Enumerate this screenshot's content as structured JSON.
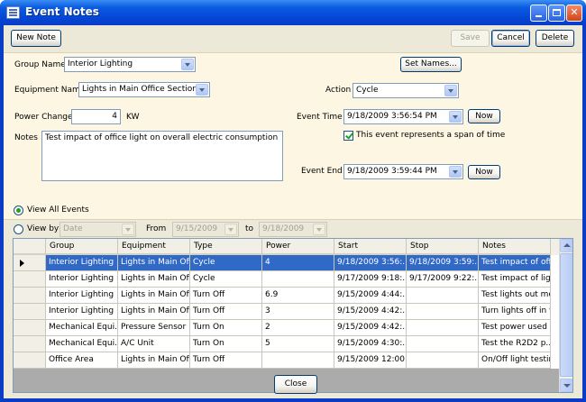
{
  "window": {
    "title": "Event Notes"
  },
  "toolbar": {
    "new_note": "New Note",
    "save": "Save",
    "cancel": "Cancel",
    "delete": "Delete"
  },
  "form": {
    "group_name_label": "Group Name",
    "group_name_value": "Interior Lighting",
    "set_names": "Set Names...",
    "equipment_name_label": "Equipment Name",
    "equipment_name_value": "Lights in Main Office Section",
    "action_label": "Action",
    "action_value": "Cycle",
    "power_change_label": "Power Change",
    "power_change_value": "4",
    "power_unit": "KW",
    "notes_label": "Notes",
    "notes_value": "Test impact of office light on overall electric consumption",
    "event_time_label": "Event Time",
    "event_time_value": "9/18/2009   3:56:54 PM",
    "now_1": "Now",
    "span_checkbox_label": "This event represents a span of time",
    "event_end_label": "Event End",
    "event_end_value": "9/18/2009   3:59:44 PM",
    "now_2": "Now"
  },
  "filter": {
    "view_all": "View All Events",
    "view_by": "View by",
    "view_by_value": "Date",
    "from_label": "From",
    "from_value": "9/15/2009",
    "to_label": "to",
    "to_value": "9/18/2009"
  },
  "table": {
    "columns": [
      "Group",
      "Equipment",
      "Type",
      "Power",
      "Start",
      "Stop",
      "Notes"
    ],
    "rows": [
      [
        "Interior Lighting",
        "Lights in Main Off...",
        "Cycle",
        "4",
        "9/18/2009 3:56:...",
        "9/18/2009 3:59:...",
        "Test impact of off..."
      ],
      [
        "Interior Lighting",
        "Lights in Main Off...",
        "Cycle",
        "",
        "9/17/2009 9:18:...",
        "9/17/2009 9:22:...",
        "Test impact of lig..."
      ],
      [
        "Interior Lighting",
        "Lights in Main Off...",
        "Turn Off",
        "6.9",
        "9/15/2009 4:44:...",
        "",
        "Test lights out mo..."
      ],
      [
        "Interior Lighting",
        "Lights in Main Off...",
        "Turn Off",
        "3",
        "9/15/2009 4:42:...",
        "",
        "Turn lights off in t..."
      ],
      [
        "Mechanical Equi...",
        "Pressure Sensor ...",
        "Turn On",
        "2",
        "9/15/2009 4:42:...",
        "",
        "Test power used ..."
      ],
      [
        "Mechanical Equi...",
        "A/C Unit",
        "Turn On",
        "5",
        "9/15/2009 4:30:...",
        "",
        "Test the R2D2 p..."
      ],
      [
        "Office Area",
        "Lights in Main Off...",
        "Turn Off",
        "",
        "9/15/2009 12:00...",
        "",
        "On/Off light testin..."
      ]
    ]
  },
  "footer": {
    "close": "Close"
  }
}
